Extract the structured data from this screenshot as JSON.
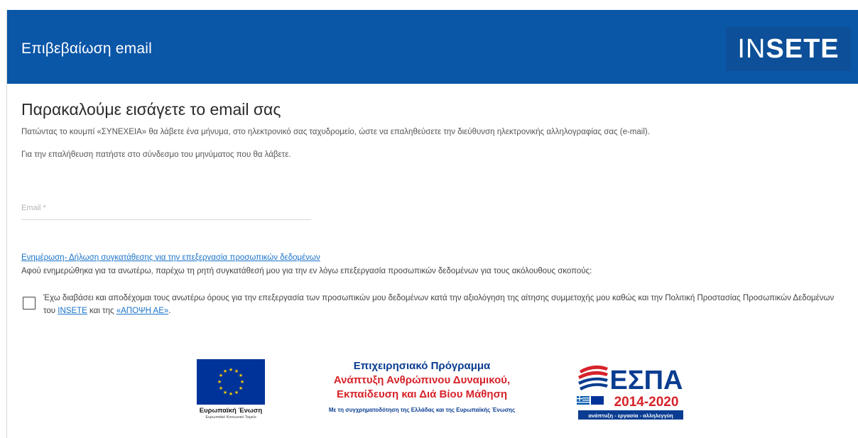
{
  "header": {
    "title": "Επιβεβαίωση email",
    "logo_light": "IN",
    "logo_bold": "SETE"
  },
  "main": {
    "heading": "Παρακαλούμε εισάγετε το email σας",
    "info_1": "Πατώντας το κουμπί «ΣΥΝΕΧΕΙΑ» θα λάβετε ένα μήνυμα, στο ηλεκτρονικό σας ταχυδρομείο, ώστε να επαληθεύσετε την διεύθυνση ηλεκτρονικής αλληλογραφίας σας (e-mail).",
    "info_2": "Για την επαλήθευση πατήστε στο σύνδεσμο του μηνύματος που θα λάβετε.",
    "email": {
      "placeholder": "Email *",
      "value": ""
    }
  },
  "consent": {
    "link": "Ενημέρωση- Δήλωση συγκατάθεσης για την επεξεργασία προσωπικών δεδομένων",
    "description": "Αφού ενημερώθηκα για τα ανωτέρω, παρέχω τη ρητή συγκατάθεσή μου για την εν λόγω επεξεργασία προσωπικών δεδομένων για τους ακόλουθους σκοπούς:",
    "checkbox_text_before": "Έχω διαβάσει και αποδέχομαι τους ανωτέρω όρους για την επεξεργασία των προσωπικών μου δεδομένων κατά την αξιολόγηση της αίτησης συμμετοχής μου καθώς και την Πολιτική Προστασίας Προσωπικών Δεδομένων του",
    "checkbox_link_1": "INSETE",
    "checkbox_text_middle": "και της",
    "checkbox_link_2": "«ΑΠΟΨΗ ΑΕ»",
    "checkbox_text_end": ".",
    "checked": false
  },
  "footer": {
    "eu_label": "Ευρωπαϊκή Ένωση",
    "eu_sub": "Ευρωπαϊκό Κοινωνικό Ταμείο",
    "op_title": "Επιχειρησιακό Πρόγραμμα",
    "op_line_1": "Ανάπτυξη Ανθρώπινου Δυναμικού,",
    "op_line_2": "Εκπαίδευση και Διά Βίου Μάθηση",
    "op_cofund": "Με τη συγχρηματοδότηση της Ελλάδας και της Ευρωπαϊκής Ένωσης",
    "espa_name": "ΕΣΠΑ",
    "espa_years": "2014-2020",
    "espa_tagline": "ανάπτυξη - εργασία - αλληλεγγύη"
  },
  "colors": {
    "header_bg": "#0a56a7",
    "link": "#1a73c9",
    "op_blue": "#0a3d91",
    "op_red": "#d6232a"
  }
}
